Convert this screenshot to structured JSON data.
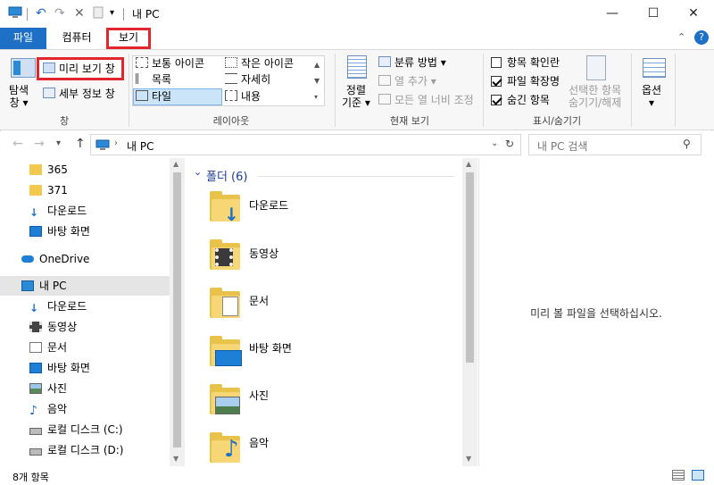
{
  "window": {
    "title": "내 PC",
    "buttons": {
      "minimize": "—",
      "maximize": "☐",
      "close": "✕"
    }
  },
  "ribbon_tabs": [
    {
      "label": "파일"
    },
    {
      "label": "컴퓨터"
    },
    {
      "label": "보기"
    }
  ],
  "ribbon": {
    "panes": {
      "nav_pane_label": "탐색\n창 ▾",
      "preview_pane": "미리 보기 창",
      "details_pane": "세부 정보 창",
      "group_label": "창"
    },
    "layout": {
      "items": [
        "보통 아이콘",
        "작은 아이콘",
        "목록",
        "자세히",
        "타일",
        "내용"
      ],
      "group_label": "레이아웃"
    },
    "current_view": {
      "sort_by": "정렬\n기준 ▾",
      "group_by": "분류 방법 ▾",
      "add_columns": "열 추가 ▾",
      "size_columns": "모든 열 너비 조정",
      "group_label": "현재 보기"
    },
    "show_hide": {
      "item_checkboxes": "항목 확인란",
      "file_extensions": "파일 확장명",
      "hidden_items": "숨긴 항목",
      "hide_selected": "선택한 항목\n숨기기/해제",
      "group_label": "표시/숨기기"
    },
    "options": "옵션\n▾"
  },
  "address": {
    "path": "내 PC"
  },
  "search": {
    "placeholder": "내 PC 검색"
  },
  "nav_pane": {
    "items": [
      {
        "label": "365",
        "icon": "folder-icon"
      },
      {
        "label": "371",
        "icon": "folder-icon"
      },
      {
        "label": "다운로드",
        "icon": "download-icon"
      },
      {
        "label": "바탕 화면",
        "icon": "desktop-icon"
      },
      {
        "label": "OneDrive",
        "icon": "cloud-icon"
      },
      {
        "label": "내 PC",
        "icon": "pc-icon"
      },
      {
        "label": "다운로드",
        "icon": "download-icon"
      },
      {
        "label": "동영상",
        "icon": "video-icon"
      },
      {
        "label": "문서",
        "icon": "document-icon"
      },
      {
        "label": "바탕 화면",
        "icon": "desktop-icon"
      },
      {
        "label": "사진",
        "icon": "picture-icon"
      },
      {
        "label": "음악",
        "icon": "music-icon"
      },
      {
        "label": "로컬 디스크 (C:)",
        "icon": "drive-icon"
      },
      {
        "label": "로컬 디스크 (D:)",
        "icon": "drive-icon"
      }
    ]
  },
  "content": {
    "group_header": "폴더 (6)",
    "folders": [
      {
        "name": "다운로드"
      },
      {
        "name": "동영상"
      },
      {
        "name": "문서"
      },
      {
        "name": "바탕 화면"
      },
      {
        "name": "사진"
      },
      {
        "name": "음악"
      }
    ]
  },
  "preview": {
    "message": "미리 볼 파일을 선택하십시오."
  },
  "status": {
    "item_count": "8개 항목"
  },
  "colors": {
    "accent": "#1e6fc6",
    "highlight_box": "#e3262d",
    "folder": "#f7d675"
  }
}
